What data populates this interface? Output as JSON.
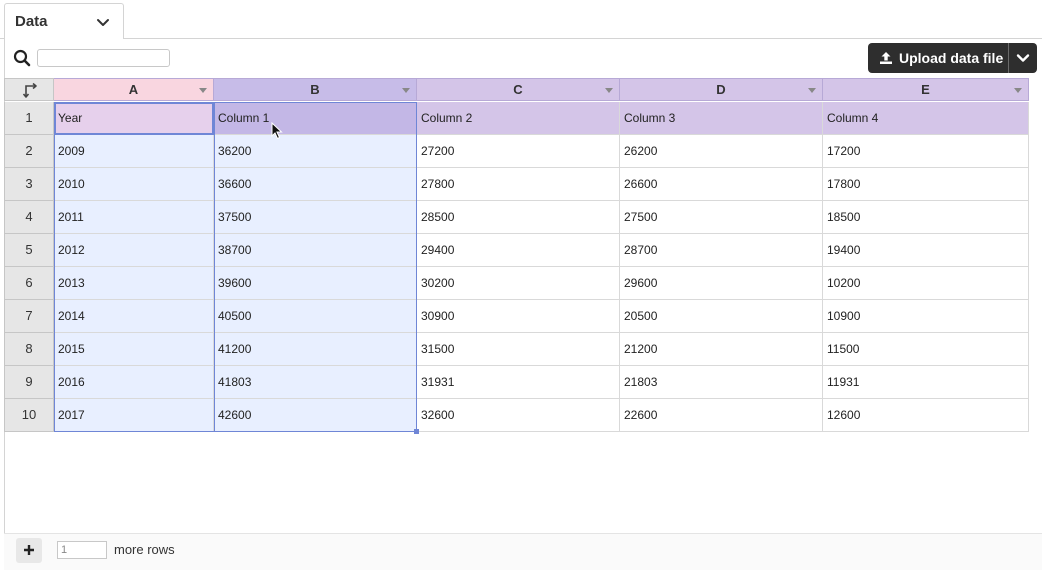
{
  "tab": {
    "label": "Data"
  },
  "search": {
    "placeholder": "",
    "value": ""
  },
  "upload": {
    "label": "Upload data file"
  },
  "columns": [
    "A",
    "B",
    "C",
    "D",
    "E"
  ],
  "column_colors": [
    "#f9d6e0",
    "#c7bce8",
    "#d4c5e8",
    "#d4c5e8",
    "#d4c5e8"
  ],
  "rows": [
    {
      "n": "1",
      "cells": [
        "Year",
        "Column 1",
        "Column 2",
        "Column 3",
        "Column 4"
      ]
    },
    {
      "n": "2",
      "cells": [
        "2009",
        "36200",
        "27200",
        "26200",
        "17200"
      ]
    },
    {
      "n": "3",
      "cells": [
        "2010",
        "36600",
        "27800",
        "26600",
        "17800"
      ]
    },
    {
      "n": "4",
      "cells": [
        "2011",
        "37500",
        "28500",
        "27500",
        "18500"
      ]
    },
    {
      "n": "5",
      "cells": [
        "2012",
        "38700",
        "29400",
        "28700",
        "19400"
      ]
    },
    {
      "n": "6",
      "cells": [
        "2013",
        "39600",
        "30200",
        "29600",
        "10200"
      ]
    },
    {
      "n": "7",
      "cells": [
        "2014",
        "40500",
        "30900",
        "20500",
        "10900"
      ]
    },
    {
      "n": "8",
      "cells": [
        "2015",
        "41200",
        "31500",
        "21200",
        "11500"
      ]
    },
    {
      "n": "9",
      "cells": [
        "2016",
        "41803",
        "31931",
        "21803",
        "11931"
      ]
    },
    {
      "n": "10",
      "cells": [
        "2017",
        "42600",
        "32600",
        "22600",
        "12600"
      ]
    }
  ],
  "footer": {
    "rows_value": "1",
    "more_rows_label": "more rows"
  },
  "icons": {
    "tab_chevron": "chevron-down-icon",
    "search": "search-icon",
    "upload": "upload-icon",
    "upload_menu": "chevron-down-icon",
    "corner": "transpose-icon",
    "add_row": "plus-icon"
  }
}
